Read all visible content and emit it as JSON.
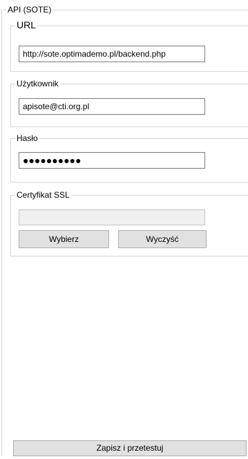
{
  "api_group": {
    "title": "API (SOTE)"
  },
  "url_group": {
    "title": "URL",
    "value": "http://sote.optimademo.pl/backend.php"
  },
  "user_group": {
    "title": "Użytkownik",
    "value": "apisote@cti.org.pl"
  },
  "password_group": {
    "title": "Hasło",
    "value": "●●●●●●●●●●"
  },
  "cert_group": {
    "title": "Certyfikat SSL",
    "value": "",
    "choose_label": "Wybierz",
    "clear_label": "Wyczyść"
  },
  "footer": {
    "save_label": "Zapisz i przetestuj"
  }
}
